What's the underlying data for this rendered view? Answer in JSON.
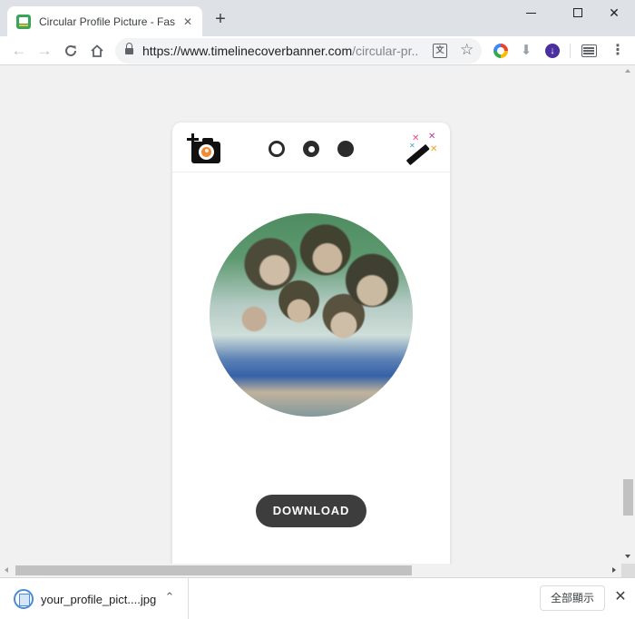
{
  "browser": {
    "tab_title": "Circular Profile Picture - Fast Or",
    "tab_close": "✕",
    "new_tab": "+",
    "url_host": "https://www.timelinecoverbanner.com",
    "url_path": "/circular-pr...",
    "translate_glyph": "文"
  },
  "icons": {
    "back": "arrow-left-icon",
    "forward": "arrow-right-icon",
    "reload": "reload-icon",
    "home": "home-icon",
    "lock": "lock-icon",
    "star": "star-icon",
    "menu": "vertical-dots-icon"
  },
  "editor": {
    "step_dots": [
      "empty",
      "selected",
      "filled"
    ],
    "download_label": "DOWNLOAD",
    "accent_color": "#3d3d3d"
  },
  "download_shelf": {
    "file_name": "your_profile_pict....jpg",
    "show_all_label": "全部顯示",
    "close_label": "✕"
  }
}
